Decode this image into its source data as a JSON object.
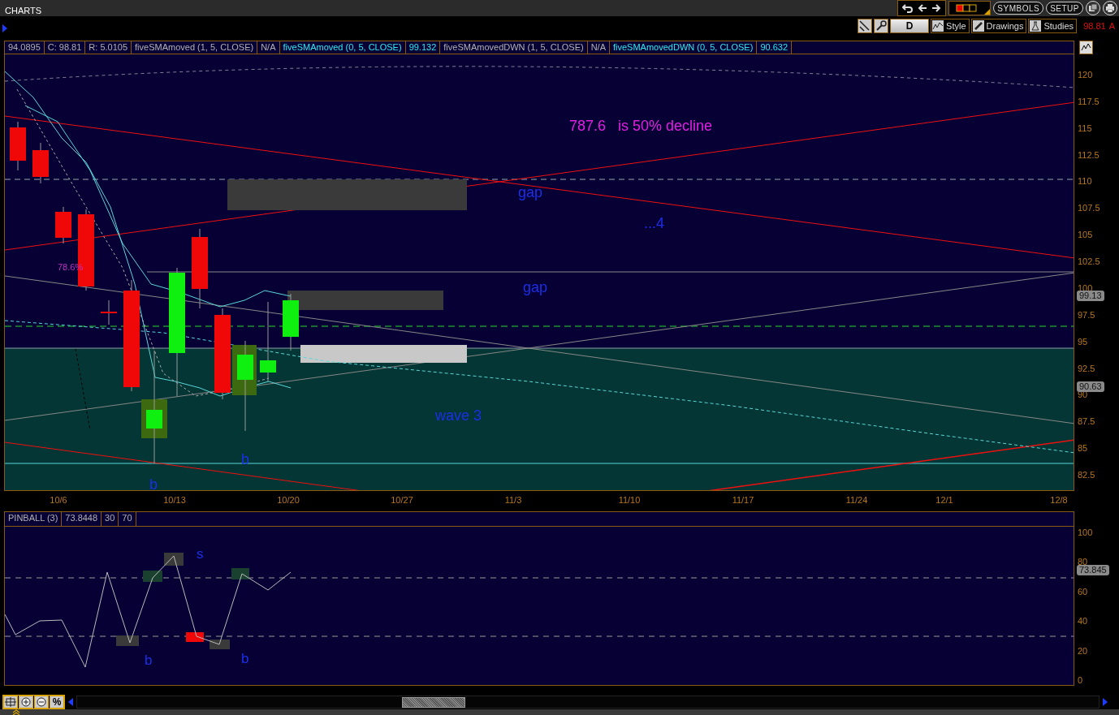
{
  "app_title": "CHARTS",
  "top_toolbar": {
    "buttons": [
      "SYMBOLS",
      "SETUP"
    ]
  },
  "chart_toolbar": {
    "period": "D",
    "buttons": [
      "Style",
      "Drawings",
      "Studies"
    ],
    "last_price": "98.81",
    "last_flag": "A"
  },
  "legend": [
    {
      "text": "94.0895",
      "highlighted": false
    },
    {
      "text": "C: 98.81",
      "highlighted": false
    },
    {
      "text": "R: 5.0105",
      "highlighted": false
    },
    {
      "text": "fiveSMAmoved (1, 5, CLOSE)",
      "highlighted": false
    },
    {
      "text": "N/A",
      "highlighted": false
    },
    {
      "text": "fiveSMAmoved (0, 5, CLOSE)",
      "highlighted": true
    },
    {
      "text": "99.132",
      "highlighted": true
    },
    {
      "text": "fiveSMAmovedDWN (1, 5, CLOSE)",
      "highlighted": false
    },
    {
      "text": "N/A",
      "highlighted": false
    },
    {
      "text": "fiveSMAmovedDWN (0, 5, CLOSE)",
      "highlighted": true
    },
    {
      "text": "90.632",
      "highlighted": true
    }
  ],
  "price_chart": {
    "y_ticks": [
      "120",
      "117.5",
      "115",
      "112.5",
      "110",
      "107.5",
      "105",
      "102.5",
      "100",
      "97.5",
      "95",
      "92.5",
      "90",
      "87.5",
      "85",
      "82.5"
    ],
    "x_labels": [
      "10/6",
      "10/13",
      "10/20",
      "10/27",
      "11/3",
      "11/10",
      "11/17",
      "11/24",
      "12/1",
      "12/8"
    ],
    "price_badges": [
      "99.13",
      "90.63"
    ],
    "annotations": [
      {
        "text": "787.6   is 50% decline",
        "color": "#e020e0"
      },
      {
        "text": "gap",
        "color": "#1e2ee8"
      },
      {
        "text": "...4",
        "color": "#1e2ee8"
      },
      {
        "text": "gap",
        "color": "#1e2ee8"
      },
      {
        "text": "78.6%",
        "color": "#c030c0"
      },
      {
        "text": "wave 3",
        "color": "#1e2ee8"
      },
      {
        "text": "b",
        "color": "#1e2ee8"
      },
      {
        "text": "b",
        "color": "#1e2ee8"
      }
    ]
  },
  "pinball": {
    "header": [
      "PINBALL (3)",
      "73.8448",
      "30",
      "70"
    ],
    "y_ticks": [
      "100",
      "80",
      "60",
      "40",
      "20",
      "0"
    ],
    "badge": "73.845",
    "annotations": [
      "s",
      "b",
      "b"
    ]
  },
  "zoom_controls": {
    "percent_label": "%"
  }
}
